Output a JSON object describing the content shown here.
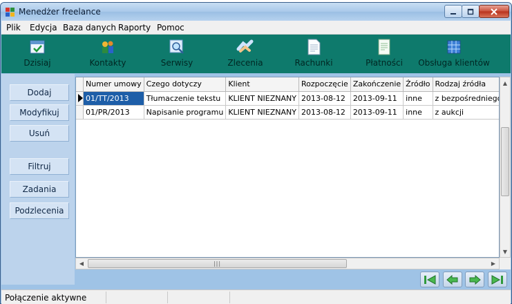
{
  "window": {
    "title": "Menedżer freelance"
  },
  "menu": [
    "Plik",
    "Edycja",
    "Baza danych",
    "Raporty",
    "Pomoc"
  ],
  "toolbar": {
    "buttons": [
      "Dzisiaj",
      "Kontakty",
      "Serwisy",
      "Zlecenia",
      "Rachunki",
      "Płatności",
      "Obsługa klientów"
    ]
  },
  "sidebar": {
    "buttons": [
      "Dodaj",
      "Modyfikuj",
      "Usuń",
      "Filtruj",
      "Zadania",
      "Podzlecenia"
    ]
  },
  "grid": {
    "columns": [
      "Numer umowy",
      "Czego dotyczy",
      "Klient",
      "Rozpoczęcie",
      "Zakończenie",
      "Źródło",
      "Rodzaj źródła"
    ],
    "rows": [
      [
        "01/TT/2013",
        "Tłumaczenie tekstu",
        "KLIENT NIEZNANY",
        "2013-08-12",
        "2013-09-11",
        "inne",
        "z bezpośredniego kont"
      ],
      [
        "01/PR/2013",
        "Napisanie programu",
        "KLIENT NIEZNANY",
        "2013-08-12",
        "2013-09-11",
        "inne",
        "z aukcji"
      ]
    ]
  },
  "status": {
    "text": "Połączenie aktywne"
  },
  "colors": {
    "toolbar": "#0e7a6c",
    "sidebar": "#bcd3ec",
    "selection": "#1d5ea8"
  }
}
